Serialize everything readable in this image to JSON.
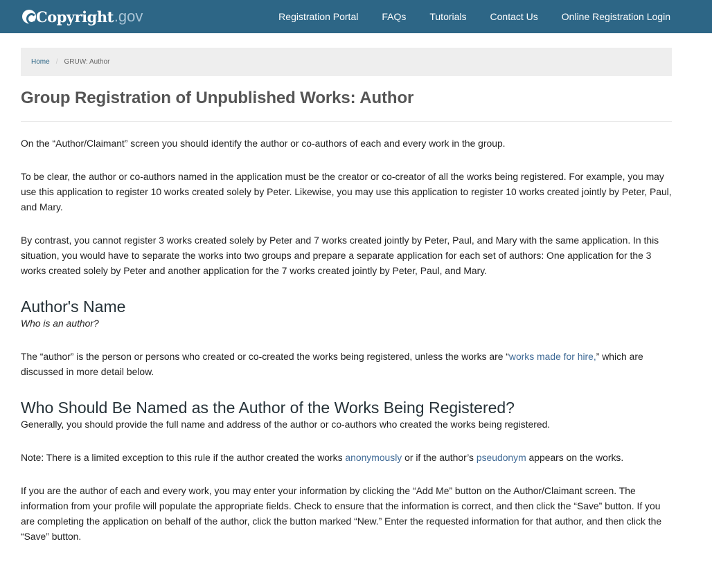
{
  "header": {
    "logo_word": "Copyright",
    "logo_tld": ".gov",
    "nav": [
      "Registration Portal",
      "FAQs",
      "Tutorials",
      "Contact Us",
      "Online Registration Login"
    ]
  },
  "breadcrumb": {
    "home": "Home",
    "separator": "/",
    "current": "GRUW: Author"
  },
  "page_title": "Group Registration of Unpublished Works: Author",
  "content": {
    "p1": "On the “Author/Claimant” screen you should identify the author or co-authors of each and every work in the group.",
    "p2": "To be clear, the author or co-authors named in the application must be the creator or co-creator of all the works being registered. For example, you may use this application to register 10 works created solely by Peter. Likewise, you may use this application to register 10 works created jointly by Peter, Paul, and Mary.",
    "p3": "By contrast, you cannot register 3 works created solely by Peter and 7 works created jointly by Peter, Paul, and Mary with the same application. In this situation, you would have to separate the works into two groups and prepare a separate application for each set of authors: One application for the 3 works created solely by Peter and another application for the 7 works created jointly by Peter, Paul, and Mary.",
    "h_author_name": "Author's Name",
    "q_who_author": "Who is an author?",
    "p4_before": "The “author” is the person or persons who created or co-created the works being registered, unless the works are “",
    "p4_link": "works made for hire,",
    "p4_after": "” which are discussed in more detail below.",
    "h_who_named": "Who Should Be Named as the Author of the Works Being Registered?",
    "p5": "Generally, you should provide the full name and address of the author or co-authors who created the works being registered.",
    "p6_before": "Note: There is a limited exception to this rule if the author created the works ",
    "p6_link1": "anonymously",
    "p6_middle": " or if the author’s ",
    "p6_link2": "pseudonym",
    "p6_after": " appears on the works.",
    "p7": "If you are the author of each and every work, you may enter your information by clicking the “Add Me” button on the Author/Claimant screen. The information from your profile will populate the appropriate fields. Check to ensure that the information is correct, and then click the “Save” button. If you are completing the application on behalf of the author, click the button marked “New.” Enter the requested information for that author, and then click the “Save” button."
  },
  "colors": {
    "navbar": "#2d6686",
    "link": "#3f6a96",
    "breadcrumb_bg": "#eeeeee"
  }
}
